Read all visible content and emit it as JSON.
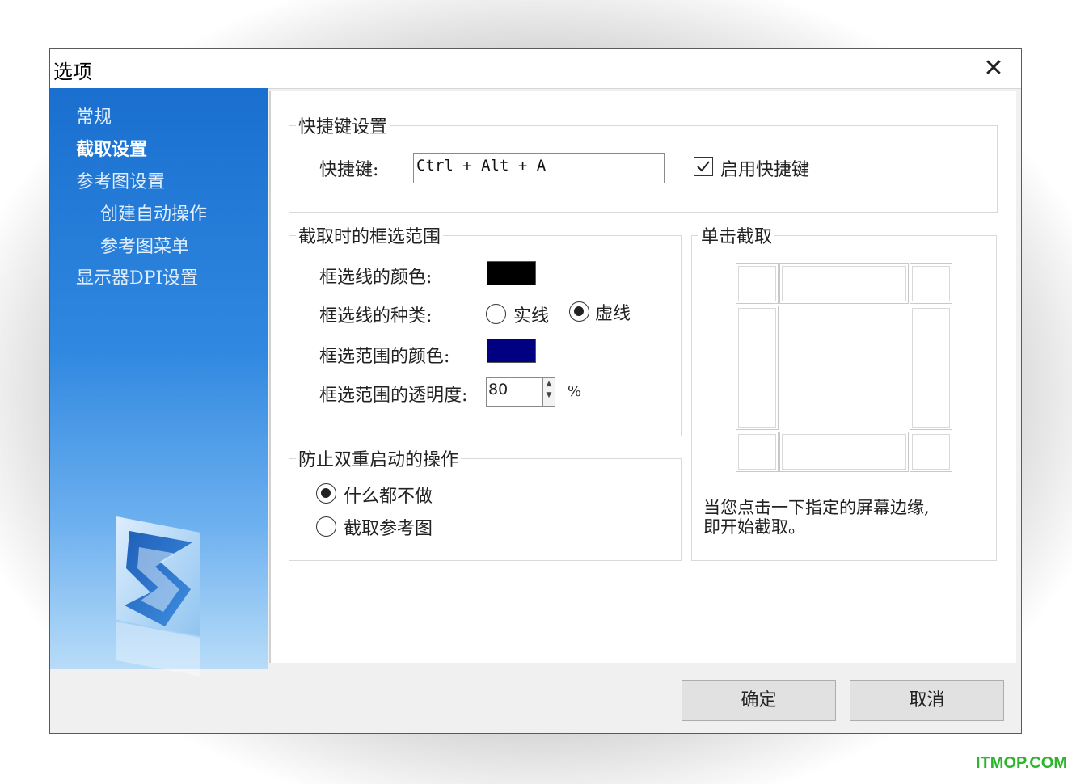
{
  "window": {
    "title": "选项",
    "close_glyph": "✕"
  },
  "sidebar": {
    "items": [
      {
        "label": "常规",
        "active": false
      },
      {
        "label": "截取设置",
        "active": true
      },
      {
        "label": "参考图设置",
        "active": false
      },
      {
        "label": "创建自动操作",
        "active": false
      },
      {
        "label": "参考图菜单",
        "active": false
      },
      {
        "label": "显示器DPI设置",
        "active": false
      }
    ]
  },
  "hotkey": {
    "legend": "快捷键设置",
    "label": "快捷键:",
    "value": "Ctrl + Alt + A",
    "enable_label": "启用快捷键",
    "enabled": true
  },
  "selection": {
    "legend": "截取时的框选范围",
    "line_color_label": "框选线的颜色:",
    "line_color": "#000000",
    "line_type_label": "框选线的种类:",
    "solid_label": "实线",
    "dashed_label": "虚线",
    "selected_type": "dashed",
    "area_color_label": "框选范围的颜色:",
    "area_color": "#000080",
    "opacity_label": "框选范围的透明度:",
    "opacity_value": "80",
    "opacity_unit": "%"
  },
  "double_launch": {
    "legend": "防止双重启动的操作",
    "option_nothing": "什么都不做",
    "option_capture_ref": "截取参考图",
    "selected": "nothing"
  },
  "click_capture": {
    "legend": "单击截取",
    "description_line1": "当您点击一下指定的屏幕边缘,",
    "description_line2": "即开始截取。"
  },
  "footer": {
    "ok_label": "确定",
    "cancel_label": "取消"
  },
  "watermark": "ITMOP.COM",
  "colors": {
    "sidebar_top": "#1a6fcf",
    "sidebar_bottom": "#b8dcf8"
  }
}
